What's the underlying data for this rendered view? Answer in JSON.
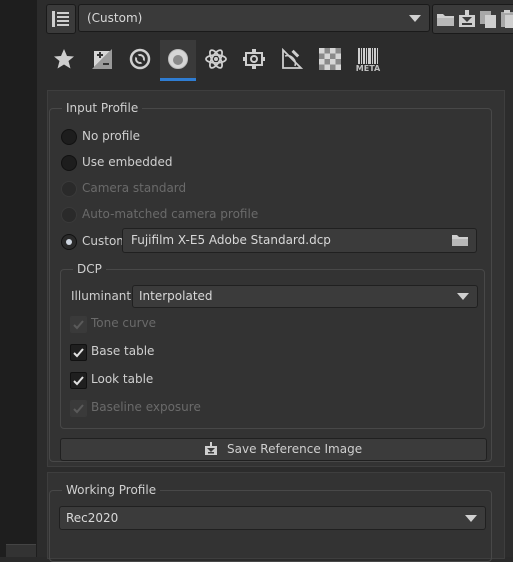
{
  "toolbar": {
    "profile_value": "(Custom)",
    "icons": [
      "profile-list-icon",
      "open-folder-icon",
      "save-icon",
      "copy-icon",
      "paste-icon"
    ]
  },
  "tabs": [
    {
      "name": "favorites",
      "icon": "star-icon",
      "active": false
    },
    {
      "name": "exposure",
      "icon": "exposure-icon",
      "active": false
    },
    {
      "name": "detail",
      "icon": "detail-icon",
      "active": false
    },
    {
      "name": "color",
      "icon": "color-icon",
      "active": true
    },
    {
      "name": "advanced",
      "icon": "atom-icon",
      "active": false
    },
    {
      "name": "transform",
      "icon": "transform-icon",
      "active": false
    },
    {
      "name": "raw",
      "icon": "raw-icon",
      "active": false
    },
    {
      "name": "raw-checker",
      "icon": "checkerboard-icon",
      "active": false
    },
    {
      "name": "meta",
      "icon": "barcode-icon",
      "label": "META",
      "active": false
    }
  ],
  "input_profile": {
    "title": "Input Profile",
    "options": {
      "no_profile": "No profile",
      "use_embedded": "Use embedded",
      "camera_standard": "Camera standard",
      "auto_matched": "Auto-matched camera profile",
      "custom": "Custom:"
    },
    "selected": "custom",
    "custom_file": "Fujifilm X-E5 Adobe Standard.dcp",
    "dcp": {
      "title": "DCP",
      "illuminant_label": "Illuminant:",
      "illuminant_value": "Interpolated",
      "tone_curve": "Tone curve",
      "base_table": "Base table",
      "look_table": "Look table",
      "baseline_exposure": "Baseline exposure"
    },
    "save_reference": "Save Reference Image"
  },
  "working_profile": {
    "title": "Working Profile",
    "value": "Rec2020"
  },
  "colors": {
    "accent": "#2f7dd3",
    "background": "#2c2c2c",
    "panel": "#333333"
  }
}
